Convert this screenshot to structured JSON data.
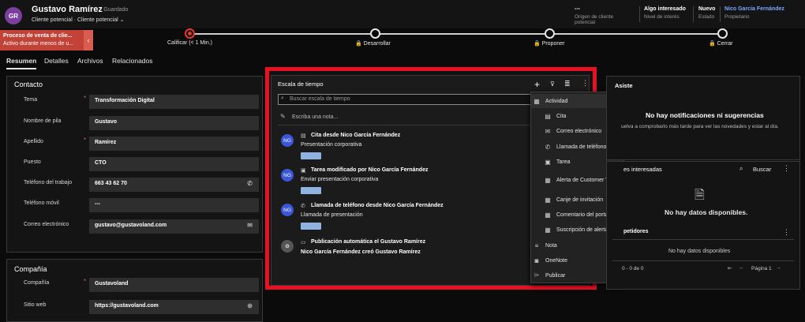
{
  "header": {
    "avatar_initials": "GR",
    "record_name": "Gustavo Ramírez",
    "saved_status": "· Guardado",
    "record_type": "Cliente potencial · Cliente potencial ⌄",
    "fields": [
      {
        "value": "---",
        "label": "Origen de cliente potencial"
      },
      {
        "value": "Algo interesado",
        "label": "Nivel de interés"
      },
      {
        "value": "Nuevo",
        "label": "Estado"
      },
      {
        "value": "Nico García Fernández",
        "label": "Propietario"
      }
    ]
  },
  "process": {
    "active_title": "Proceso de venta de clie...",
    "active_sub": "Activo durante menos de u...",
    "stages": [
      {
        "label": "Calificar  (< 1 Min.)"
      },
      {
        "label": "🔒 Desarrollar"
      },
      {
        "label": "🔒 Proponer"
      },
      {
        "label": "🔒 Cerrar"
      }
    ]
  },
  "tabs": [
    "Resumen",
    "Detalles",
    "Archivos",
    "Relacionados"
  ],
  "contact": {
    "title": "Contacto",
    "fields": [
      {
        "label": "Tema",
        "required": true,
        "value": "Transformación Digital"
      },
      {
        "label": "Nombre de pila",
        "required": false,
        "value": "Gustavo"
      },
      {
        "label": "Apellido",
        "required": true,
        "value": "Ramírez"
      },
      {
        "label": "Puesto",
        "required": false,
        "value": "CTO"
      },
      {
        "label": "Teléfono del trabajo",
        "required": false,
        "value": "663 43 62 70"
      },
      {
        "label": "Teléfono móvil",
        "required": false,
        "value": "---"
      },
      {
        "label": "Correo electrónico",
        "required": false,
        "value": "gustavo@gustavoland.com"
      }
    ]
  },
  "company": {
    "title": "Compañía",
    "fields": [
      {
        "label": "Compañía",
        "required": true,
        "value": "Gustavoland"
      },
      {
        "label": "Sitio web",
        "required": false,
        "value": "https://gustavoland.com"
      }
    ]
  },
  "timeline": {
    "title": "Escala de tiempo",
    "search_placeholder": "Buscar escala de tiempo",
    "note_placeholder": "Escriba una nota...",
    "entries": [
      {
        "initials": "NG",
        "title": "Cita desde Nico García Fernández",
        "sub": "Presentación corporativa"
      },
      {
        "initials": "NG",
        "title": "Tarea modificado por Nico García Fernández",
        "sub": "Enviar presentación corporativa"
      },
      {
        "initials": "NG",
        "title": "Llamada de teléfono desde Nico García Fernández",
        "sub": "Llamada de presentación"
      },
      {
        "initials": "",
        "title": "Publicación automática el Gustavo Ramírez",
        "sub": "Nico García Fernández creó Gustavo Ramírez"
      }
    ]
  },
  "add_menu": [
    {
      "icon": "activity-icon",
      "label": "Actividad",
      "sub": false
    },
    {
      "icon": "appointment-icon",
      "label": "Cita",
      "sub": true
    },
    {
      "icon": "email-icon",
      "label": "Correo electrónico",
      "sub": true
    },
    {
      "icon": "phone-icon",
      "label": "Llamada de teléfono",
      "sub": true
    },
    {
      "icon": "task-icon",
      "label": "Tarea",
      "sub": true
    },
    {
      "icon": "customer-voice-icon",
      "label": "Alerta de Customer Voice",
      "sub": true
    },
    {
      "icon": "invitation-icon",
      "label": "Canje de invitación",
      "sub": true
    },
    {
      "icon": "portal-comment-icon",
      "label": "Comentario del portal",
      "sub": true
    },
    {
      "icon": "alert-subscription-icon",
      "label": "Suscripción de alerta",
      "sub": true
    },
    {
      "icon": "note-icon",
      "label": "Nota",
      "sub": false
    },
    {
      "icon": "onenote-icon",
      "label": "OneNote",
      "sub": false
    },
    {
      "icon": "publish-icon",
      "label": "Publicar",
      "sub": false
    }
  ],
  "assistant": {
    "title": "Asiste",
    "empty_title": "No hay notificaciones ni sugerencias",
    "empty_sub": "uelva a comprobarlo más tarde para ver las novedades y estar al día."
  },
  "stakeholders": {
    "title": "es interesadas",
    "search_label": "Buscar",
    "empty": "No hay datos disponibles.",
    "competitors_title": "petidores",
    "competitors_empty": "No hay datos disponibles",
    "pager_count": "0 - 0 de 0",
    "pager_page": "Página 1"
  }
}
